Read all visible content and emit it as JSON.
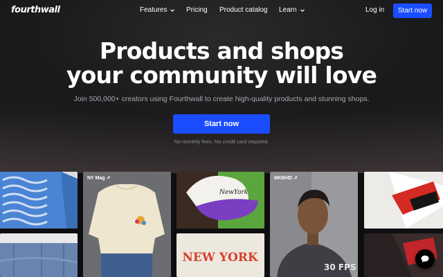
{
  "nav": {
    "logo": "fourthwall",
    "items": [
      {
        "label": "Features",
        "dropdown": true
      },
      {
        "label": "Pricing",
        "dropdown": false
      },
      {
        "label": "Product catalog",
        "dropdown": false
      },
      {
        "label": "Learn",
        "dropdown": true
      }
    ],
    "login": "Log in",
    "cta": "Start now"
  },
  "hero": {
    "title_line1": "Products and shops",
    "title_line2": "your community will love",
    "subtitle": "Join 500,000+ creators using Fourthwall to create high-quality products and stunning shops.",
    "cta": "Start now",
    "note": "No monthly fees. No credit card required."
  },
  "gallery": {
    "labels": {
      "nymag": "NY Mag ↗",
      "mkbhd": "MKBHD ↗"
    },
    "print_text": {
      "hat": "NewYork",
      "tee": "NEW YORK",
      "shirt": "30 FPS"
    }
  },
  "colors": {
    "accent": "#1a4dff",
    "background": "#0e0e10"
  },
  "icons": {
    "dropdown": "chevron-down-icon",
    "chat": "chat-bubble-icon"
  }
}
